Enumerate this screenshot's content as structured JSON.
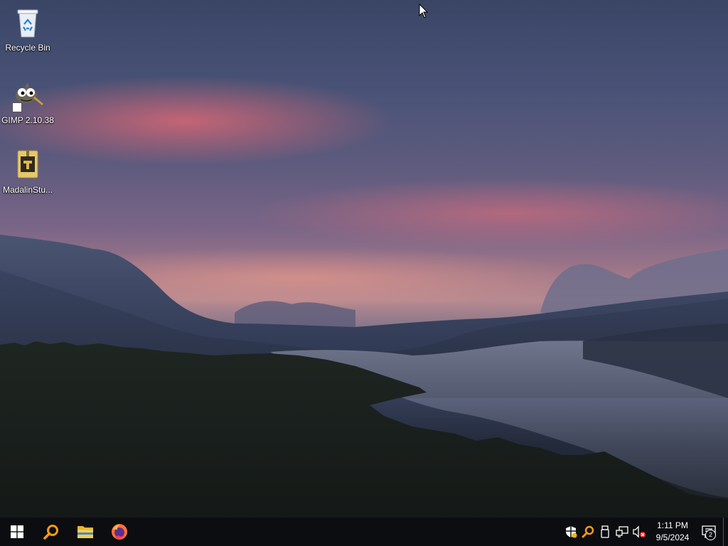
{
  "desktop": {
    "icons": [
      {
        "label": "Recycle Bin",
        "icon": "recycle-bin-icon"
      },
      {
        "label": "GIMP 2.10.38",
        "icon": "gimp-icon"
      },
      {
        "label": "MadalinStu...",
        "icon": "game-archive-icon"
      }
    ]
  },
  "taskbar": {
    "start": {
      "icon": "windows-logo-icon"
    },
    "search": {
      "icon": "search-icon"
    },
    "pinned": [
      {
        "icon": "file-explorer-icon"
      },
      {
        "icon": "firefox-icon"
      }
    ],
    "tray": {
      "icons": [
        "security-shield-icon",
        "search-indexer-icon",
        "usb-device-icon",
        "network-icon",
        "volume-muted-icon"
      ],
      "clock": {
        "time": "1:11 PM",
        "date": "9/5/2024"
      },
      "notifications": {
        "icon": "action-center-icon",
        "count": "2"
      }
    }
  },
  "colors": {
    "taskbar_bg": "#0c0d10",
    "windows_blue": "#ffffff",
    "search_orange": "#f39c12"
  }
}
